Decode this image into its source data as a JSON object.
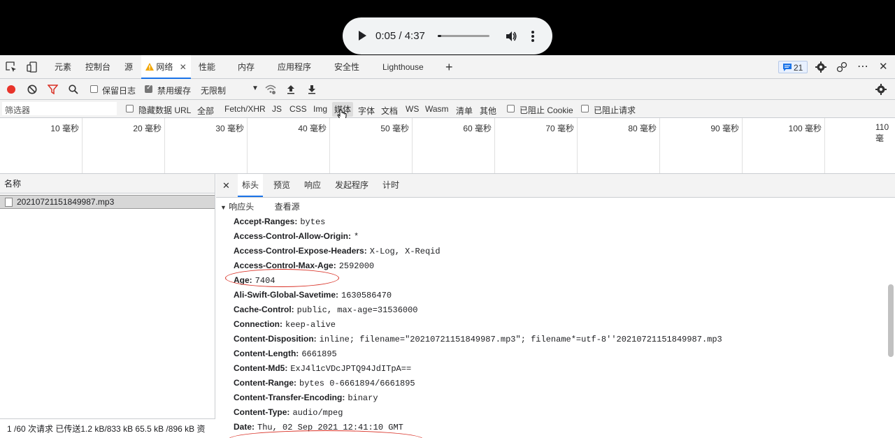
{
  "player": {
    "time": "0:05 / 4:37",
    "progress_fraction": 0.018
  },
  "tabs": [
    {
      "label": "元素"
    },
    {
      "label": "控制台"
    },
    {
      "label": "源"
    },
    {
      "label": "网络"
    },
    {
      "label": "性能"
    },
    {
      "label": "内存"
    },
    {
      "label": "应用程序"
    },
    {
      "label": "安全性"
    },
    {
      "label": "Lighthouse"
    }
  ],
  "issues_count": "21",
  "toolbar": {
    "preserve_log": "保留日志",
    "disable_cache": "禁用缓存",
    "throttle": "无限制"
  },
  "filter": {
    "placeholder": "筛选器",
    "hide_data_url": "隐藏数据 URL",
    "types": [
      "全部",
      "Fetch/XHR",
      "JS",
      "CSS",
      "Img",
      "媒体",
      "字体",
      "文档",
      "WS",
      "Wasm",
      "清单",
      "其他"
    ],
    "blocked_cookies": "已阻止 Cookie",
    "blocked_requests": "已阻止请求"
  },
  "timeline_ticks": [
    "10 毫秒",
    "20 毫秒",
    "30 毫秒",
    "40 毫秒",
    "50 毫秒",
    "60 毫秒",
    "70 毫秒",
    "80 毫秒",
    "90 毫秒",
    "100 毫秒",
    "110 毫"
  ],
  "request_list": {
    "header": "名称",
    "rows": [
      {
        "name": "20210721151849987.mp3"
      }
    ],
    "status": "1 /60 次请求  已传送1.2 kB/833 kB  65.5 kB /896 kB 资"
  },
  "detail_tabs": [
    "标头",
    "预览",
    "响应",
    "发起程序",
    "计时"
  ],
  "response_headers": {
    "title": "响应头",
    "view_source": "查看源",
    "items": [
      {
        "k": "Accept-Ranges:",
        "v": "bytes"
      },
      {
        "k": "Access-Control-Allow-Origin:",
        "v": "*"
      },
      {
        "k": "Access-Control-Expose-Headers:",
        "v": "X-Log, X-Reqid"
      },
      {
        "k": "Access-Control-Max-Age:",
        "v": "2592000"
      },
      {
        "k": "Age:",
        "v": "7404"
      },
      {
        "k": "Ali-Swift-Global-Savetime:",
        "v": "1630586470"
      },
      {
        "k": "Cache-Control:",
        "v": "public, max-age=31536000"
      },
      {
        "k": "Connection:",
        "v": "keep-alive"
      },
      {
        "k": "Content-Disposition:",
        "v": "inline; filename=\"20210721151849987.mp3\"; filename*=utf-8''20210721151849987.mp3"
      },
      {
        "k": "Content-Length:",
        "v": "6661895"
      },
      {
        "k": "Content-Md5:",
        "v": "ExJ4l1cVDcJPTQ94JdITpA=="
      },
      {
        "k": "Content-Range:",
        "v": "bytes 0-6661894/6661895"
      },
      {
        "k": "Content-Transfer-Encoding:",
        "v": "binary"
      },
      {
        "k": "Content-Type:",
        "v": "audio/mpeg"
      },
      {
        "k": "Date:",
        "v": "Thu, 02 Sep 2021 12:41:10 GMT"
      }
    ]
  },
  "colors": {
    "record": "#e8332a",
    "filter_icon": "#d93025",
    "accent": "#1a73e8",
    "annotation": "#d93025"
  }
}
